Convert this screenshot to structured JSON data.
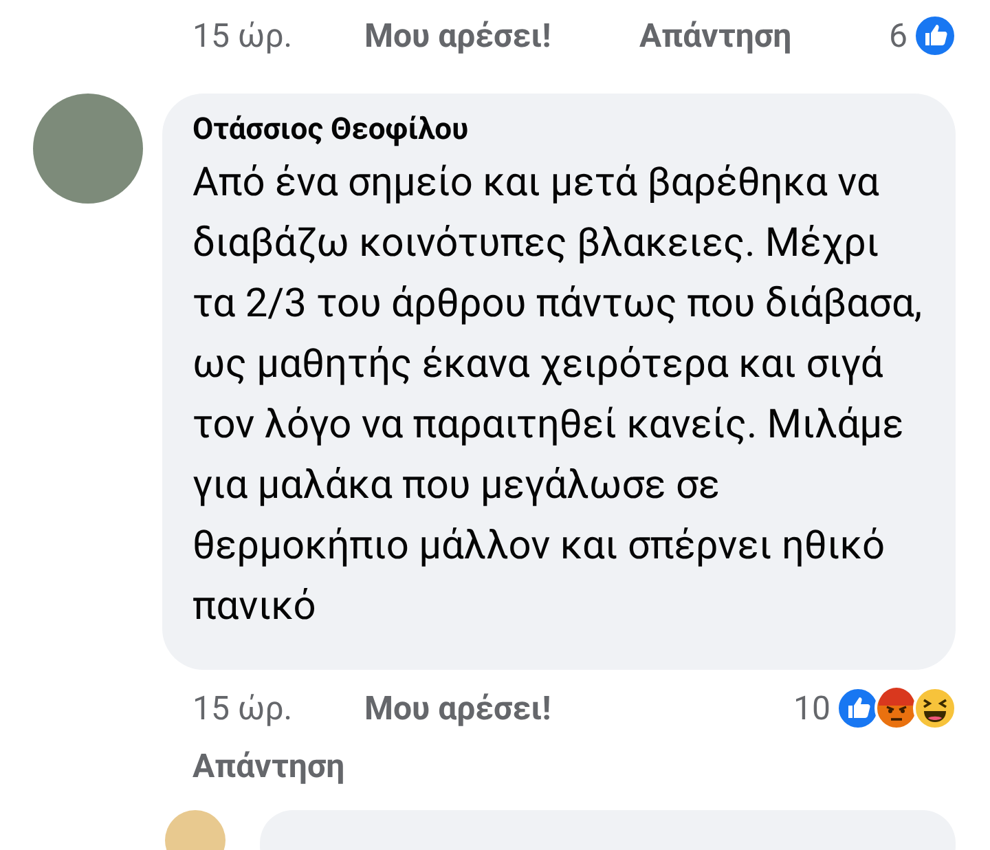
{
  "previous_comment_actions": {
    "time": "15 ώρ.",
    "like": "Μου αρέσει!",
    "reply": "Απάντηση",
    "reaction_count": "6",
    "reactions": [
      {
        "kind": "like"
      }
    ]
  },
  "comment": {
    "author": "Οτάσσιος Θεοφίλου",
    "text": "Από ένα σημείο και μετά βαρέθηκα να διαβάζω κοινότυπες βλακειες. Μέχρι τα 2/3 του άρθρου πάντως που διάβασα, ως μαθητής έκανα χειρότερα και σιγά τον λόγο να παραιτηθεί κανείς. Μιλάμε για μαλάκα που μεγάλωσε σε θερμοκήπιο μάλλον και σπέρνει ηθικό πανικό",
    "time": "15 ώρ.",
    "like": "Μου αρέσει!",
    "reply": "Απάντηση",
    "reaction_count": "10",
    "reactions": [
      {
        "kind": "like"
      },
      {
        "kind": "angry"
      },
      {
        "kind": "haha"
      }
    ]
  }
}
